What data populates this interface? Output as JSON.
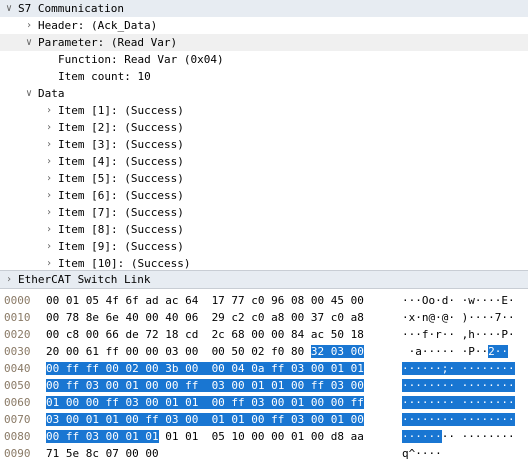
{
  "tree": {
    "rows": [
      {
        "text": "S7 Communication",
        "indent": 0,
        "arrow": "v",
        "style": "hdr"
      },
      {
        "text": "Header: (Ack_Data)",
        "indent": 1,
        "arrow": ">",
        "style": ""
      },
      {
        "text": "Parameter: (Read Var)",
        "indent": 1,
        "arrow": "v",
        "style": "sel"
      },
      {
        "text": "Function: Read Var (0x04)",
        "indent": 2,
        "arrow": "",
        "style": ""
      },
      {
        "text": "Item count: 10",
        "indent": 2,
        "arrow": "",
        "style": ""
      },
      {
        "text": "Data",
        "indent": 1,
        "arrow": "v",
        "style": ""
      },
      {
        "text": "Item [1]: (Success)",
        "indent": 2,
        "arrow": ">",
        "style": ""
      },
      {
        "text": "Item [2]: (Success)",
        "indent": 2,
        "arrow": ">",
        "style": ""
      },
      {
        "text": "Item [3]: (Success)",
        "indent": 2,
        "arrow": ">",
        "style": ""
      },
      {
        "text": "Item [4]: (Success)",
        "indent": 2,
        "arrow": ">",
        "style": ""
      },
      {
        "text": "Item [5]: (Success)",
        "indent": 2,
        "arrow": ">",
        "style": ""
      },
      {
        "text": "Item [6]: (Success)",
        "indent": 2,
        "arrow": ">",
        "style": ""
      },
      {
        "text": "Item [7]: (Success)",
        "indent": 2,
        "arrow": ">",
        "style": ""
      },
      {
        "text": "Item [8]: (Success)",
        "indent": 2,
        "arrow": ">",
        "style": ""
      },
      {
        "text": "Item [9]: (Success)",
        "indent": 2,
        "arrow": ">",
        "style": ""
      },
      {
        "text": "Item [10]: (Success)",
        "indent": 2,
        "arrow": ">",
        "style": ""
      }
    ],
    "section": {
      "text": "EtherCAT Switch Link",
      "arrow": ">"
    }
  },
  "hexdump": {
    "rows": [
      {
        "offset": "0000",
        "pre": "00 01 05 4f 6f ad ac 64  17 77 c0 96 08 00 45 00",
        "hl": "",
        "post": "",
        "ascii_pre": "···Oo·d· ·w····E·",
        "ascii_hl": "",
        "ascii_post": ""
      },
      {
        "offset": "0010",
        "pre": "00 78 8e 6e 40 00 40 06  29 c2 c0 a8 00 37 c0 a8",
        "hl": "",
        "post": "",
        "ascii_pre": "·x·n@·@· )····7··",
        "ascii_hl": "",
        "ascii_post": ""
      },
      {
        "offset": "0020",
        "pre": "00 c8 00 66 de 72 18 cd  2c 68 00 00 84 ac 50 18",
        "hl": "",
        "post": "",
        "ascii_pre": "···f·r·· ,h····P·",
        "ascii_hl": "",
        "ascii_post": ""
      },
      {
        "offset": "0030",
        "pre": "20 00 61 ff 00 00 03 00  00 50 02 f0 80 ",
        "hl": "32 03 00",
        "post": "",
        "ascii_pre": " ·a····· ·P··",
        "ascii_hl": "2··",
        "ascii_post": ""
      },
      {
        "offset": "0040",
        "pre": "",
        "hl": "00 ff ff 00 02 00 3b 00  00 04 0a ff 03 00 01 01",
        "post": "",
        "ascii_pre": "",
        "ascii_hl": "······;· ········",
        "ascii_post": ""
      },
      {
        "offset": "0050",
        "pre": "",
        "hl": "00 ff 03 00 01 00 00 ff  03 00 01 01 00 ff 03 00",
        "post": "",
        "ascii_pre": "",
        "ascii_hl": "········ ········",
        "ascii_post": ""
      },
      {
        "offset": "0060",
        "pre": "",
        "hl": "01 00 00 ff 03 00 01 01  00 ff 03 00 01 00 00 ff",
        "post": "",
        "ascii_pre": "",
        "ascii_hl": "········ ········",
        "ascii_post": ""
      },
      {
        "offset": "0070",
        "pre": "",
        "hl": "03 00 01 01 00 ff 03 00  01 01 00 ff 03 00 01 00",
        "post": "",
        "ascii_pre": "",
        "ascii_hl": "········ ········",
        "ascii_post": ""
      },
      {
        "offset": "0080",
        "pre": "",
        "hl": "00 ff 03 00 01 01",
        "post": " 01 01  05 10 00 00 01 00 d8 aa",
        "ascii_pre": "",
        "ascii_hl": "······",
        "ascii_post": "·· ········"
      },
      {
        "offset": "0090",
        "pre": "71 5e 8c 07 00 00",
        "hl": "",
        "post": "",
        "ascii_pre": "q^····",
        "ascii_hl": "",
        "ascii_post": ""
      }
    ]
  },
  "colors": {
    "highlight": "#1976d2",
    "header_bg": "#e7ecf2",
    "offset_text": "#8a7a66"
  }
}
